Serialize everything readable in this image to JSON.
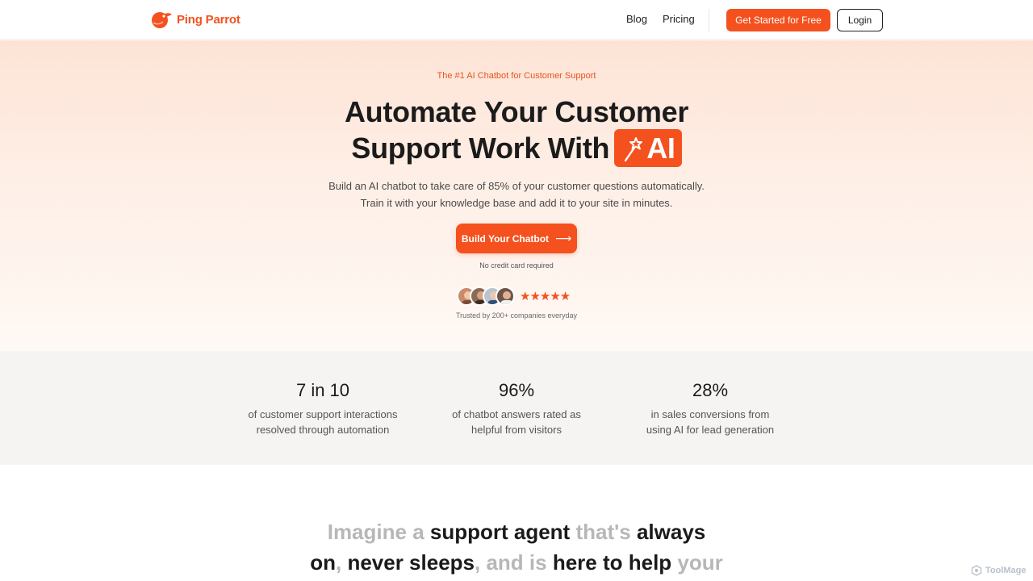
{
  "nav": {
    "brand": "Ping Parrot",
    "links": [
      {
        "label": "Blog"
      },
      {
        "label": "Pricing"
      }
    ],
    "cta_label": "Get Started for Free",
    "login_label": "Login"
  },
  "hero": {
    "eyebrow": "The #1 AI Chatbot for Customer Support",
    "headline_line1": "Automate Your Customer",
    "headline_line2": "Support Work With",
    "badge_text": "AI",
    "badge_icon": "magic-wand-icon",
    "subtitle_line1": "Build an AI chatbot to take care of 85% of your customer questions automatically.",
    "subtitle_line2": "Train it with your knowledge base and add it to your site in minutes.",
    "cta_label": "Build Your Chatbot",
    "cta_arrow": "⟶",
    "note": "No credit card required",
    "stars": "★★★★★",
    "rating": 5,
    "trusted": "Trusted by 200+ companies everyday"
  },
  "stats": [
    {
      "value": "7 in 10",
      "desc_line1": "of customer support interactions",
      "desc_line2": "resolved through automation"
    },
    {
      "value": "96%",
      "desc_line1": "of chatbot answers rated as",
      "desc_line2": "helpful from visitors"
    },
    {
      "value": "28%",
      "desc_line1": "in sales conversions from",
      "desc_line2": "using AI for lead generation"
    }
  ],
  "imagine": {
    "line1": [
      {
        "text": "Imagine a ",
        "dim": true
      },
      {
        "text": "support agent ",
        "dim": false
      },
      {
        "text": "that's ",
        "dim": true
      },
      {
        "text": "always",
        "dim": false
      }
    ],
    "line2": [
      {
        "text": "on",
        "dim": false
      },
      {
        "text": ", ",
        "dim": true
      },
      {
        "text": "never sleeps",
        "dim": false
      },
      {
        "text": ", and is ",
        "dim": true
      },
      {
        "text": "here to help ",
        "dim": false
      },
      {
        "text": "your",
        "dim": true
      }
    ]
  },
  "watermark": "ToolMage",
  "colors": {
    "accent": "#f4511e",
    "text": "#1b1b1b",
    "muted": "#b7b7b7",
    "stats_bg": "#f5f4f3"
  }
}
